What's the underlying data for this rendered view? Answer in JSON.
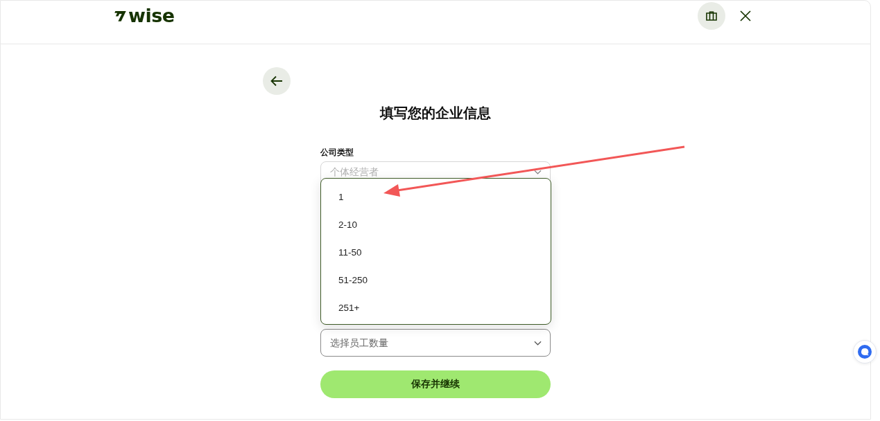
{
  "header": {
    "logo": "wise"
  },
  "title": "填写您的企业信息",
  "form": {
    "fields": [
      {
        "label": "公司类型",
        "value": "个体经营者",
        "disabled": true
      },
      {
        "placeholder": "选择员工数量",
        "disabled": false
      }
    ],
    "dropdown": {
      "options": [
        {
          "label": "1",
          "selected": false
        },
        {
          "label": "2-10",
          "selected": false
        },
        {
          "label": "11-50",
          "selected": false
        },
        {
          "label": "51-250",
          "selected": false
        },
        {
          "label": "251+",
          "selected": false
        }
      ]
    },
    "submit_button": "保存并继续"
  }
}
